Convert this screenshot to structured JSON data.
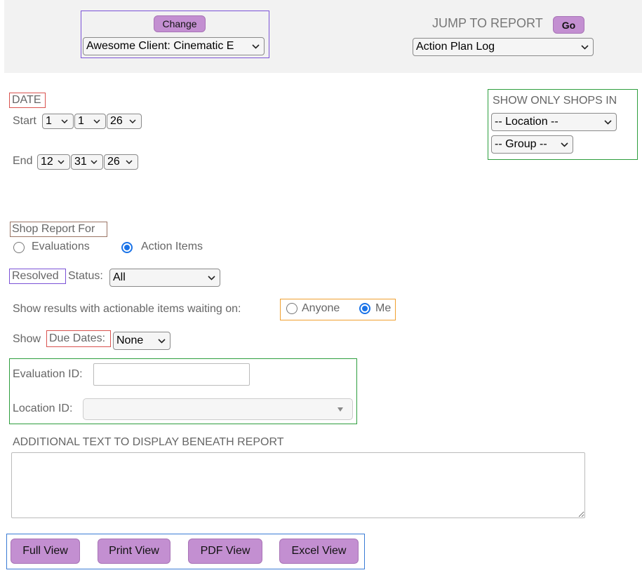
{
  "header": {
    "change_button": "Change",
    "client_select": "Awesome Client: Cinematic E",
    "jump_label": "JUMP TO REPORT",
    "go_button": "Go",
    "report_select": "Action Plan Log"
  },
  "date": {
    "heading": "DATE",
    "start_label": "Start",
    "start_month": "1",
    "start_day": "1",
    "start_year": "26",
    "end_label": "End",
    "end_month": "12",
    "end_day": "31",
    "end_year": "26"
  },
  "shops_filter": {
    "heading": "SHOW ONLY SHOPS IN",
    "location_select": "-- Location --",
    "group_select": "-- Group --"
  },
  "shop_report": {
    "heading": "Shop Report For",
    "option_evaluations": "Evaluations",
    "option_action_items": "Action Items",
    "selected": "Action Items"
  },
  "resolved": {
    "label_highlight": "Resolved",
    "label_rest": "Status:",
    "select_value": "All"
  },
  "waiting_on": {
    "label": "Show results with actionable items waiting on:",
    "option_anyone": "Anyone",
    "option_me": "Me",
    "selected": "Me"
  },
  "due_dates": {
    "label_show": "Show",
    "label_highlight": "Due Dates:",
    "select_value": "None"
  },
  "ids": {
    "evaluation_label": "Evaluation ID:",
    "evaluation_value": "",
    "location_label": "Location ID:",
    "location_value": ""
  },
  "additional_text": {
    "label": "ADDITIONAL TEXT TO DISPLAY BENEATH REPORT",
    "value": ""
  },
  "view_buttons": {
    "full": "Full View",
    "print": "Print View",
    "pdf": "PDF View",
    "excel": "Excel View"
  },
  "colors": {
    "button_purple": "#c38fd1",
    "box_purple": "#7b52d6",
    "box_red": "#d9534f",
    "box_green": "#2e9e3e",
    "box_brown": "#9b7565",
    "box_orange": "#f0a030",
    "box_blue": "#3a7bd5",
    "radio_selected": "#1a73e8"
  }
}
